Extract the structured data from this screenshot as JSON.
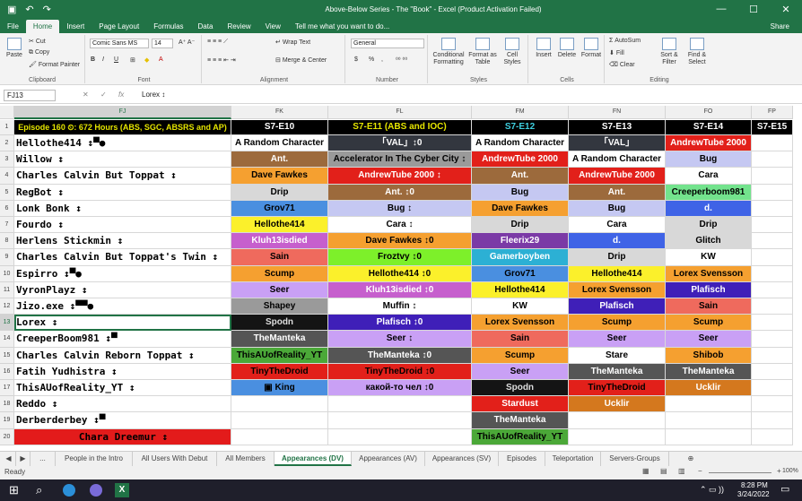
{
  "window": {
    "title": "Above-Below Series - The \"Book\" - Excel (Product Activation Failed)"
  },
  "quick_access": {
    "save": "▣",
    "undo": "↶",
    "redo": "↷"
  },
  "window_controls": {
    "min": "—",
    "max": "☐",
    "close": "✕"
  },
  "ribbon_tabs": [
    "File",
    "Home",
    "Insert",
    "Page Layout",
    "Formulas",
    "Data",
    "Review",
    "View"
  ],
  "tell_me": "Tell me what you want to do...",
  "share": "Share",
  "clipboard": {
    "paste": "Paste",
    "cut": "Cut",
    "copy": "Copy",
    "format_painter": "Format Painter",
    "label": "Clipboard"
  },
  "font": {
    "name": "Comic Sans MS",
    "size": "14",
    "bold": "B",
    "italic": "I",
    "underline": "U",
    "label": "Font"
  },
  "alignment": {
    "wrap": "Wrap Text",
    "merge": "Merge & Center",
    "label": "Alignment"
  },
  "number": {
    "format": "General",
    "currency": "$",
    "percent": "%",
    "comma": ",",
    "label": "Number"
  },
  "styles": {
    "conditional": "Conditional Formatting",
    "format_table": "Format as Table",
    "cell_styles": "Cell Styles",
    "label": "Styles"
  },
  "cells": {
    "insert": "Insert",
    "delete": "Delete",
    "format": "Format",
    "label": "Cells"
  },
  "editing": {
    "autosum": "AutoSum",
    "fill": "Fill",
    "clear": "Clear",
    "sort": "Sort & Filter",
    "find": "Find & Select",
    "label": "Editing"
  },
  "formula_bar": {
    "name_box": "FJ13",
    "fx": "fx",
    "value": "Lorex ↕"
  },
  "columns": {
    "fj": "FJ",
    "fk": "FK",
    "fl": "FL",
    "fm": "FM",
    "fn": "FN",
    "fo": "FO",
    "fp": "FP"
  },
  "row1": {
    "fj": "Episode 160 ⏲: 672 Hours (ABS, SGC, ABSRS and AP)",
    "fk": "S7-E10",
    "fl": "S7-E11 (ABS and IOC)",
    "fm": "S7-E12",
    "fn": "S7-E13",
    "fo": "S7-E14",
    "fp": "S7-E15"
  },
  "rows": [
    {
      "num": "2",
      "name": "Hellothe414 ↕▀●",
      "fk": "A Random Character",
      "fl": "「VAL」↕0",
      "fm": "A Random Character",
      "fn": "「VAL」",
      "fo": "AndrewTube 2000"
    },
    {
      "num": "3",
      "name": "Willow ↕",
      "fk": "Ant.",
      "fl": "Accelerator In The Cyber City ↕",
      "fm": "AndrewTube 2000",
      "fn": "A Random Character",
      "fo": "Bug"
    },
    {
      "num": "4",
      "name": "Charles Calvin But Toppat ↕",
      "fk": "Dave Fawkes",
      "fl": "AndrewTube 2000 ↕",
      "fm": "Ant.",
      "fn": "AndrewTube 2000",
      "fo": "Cara"
    },
    {
      "num": "5",
      "name": "RegBot ↕",
      "fk": "Drip",
      "fl": "Ant. ↕0",
      "fm": "Bug",
      "fn": "Ant.",
      "fo": "Creeperboom981"
    },
    {
      "num": "6",
      "name": "Lonk Bonk ↕",
      "fk": "Grov71",
      "fl": "Bug ↕",
      "fm": "Dave Fawkes",
      "fn": "Bug",
      "fo": "d."
    },
    {
      "num": "7",
      "name": "Fourdo ↕",
      "fk": "Hellothe414",
      "fl": "Cara ↕",
      "fm": "Drip",
      "fn": "Cara",
      "fo": "Drip"
    },
    {
      "num": "8",
      "name": "Herlens Stickmin ↕",
      "fk": "Kluh13isdied",
      "fl": "Dave Fawkes ↕0",
      "fm": "Fleerix29",
      "fn": "d.",
      "fo": "Glitch"
    },
    {
      "num": "9",
      "name": "Charles Calvin But Toppat's Twin ↕",
      "fk": "Sain",
      "fl": "Froztvy ↕0",
      "fm": "Gamerboyben",
      "fn": "Drip",
      "fo": "KW"
    },
    {
      "num": "10",
      "name": "Espirro ↕▀●",
      "fk": "Scump",
      "fl": "Hellothe414 ↕0",
      "fm": "Grov71",
      "fn": "Hellothe414",
      "fo": "Lorex Svensson"
    },
    {
      "num": "11",
      "name": "VyronPlayz ↕",
      "fk": "Seer",
      "fl": "Kluh13isdied ↕0",
      "fm": "Hellothe414",
      "fn": "Lorex Svensson",
      "fo": "Plafisch"
    },
    {
      "num": "12",
      "name": "Jizo.exe ↕▀▀●",
      "fk": "Shapey",
      "fl": "Muffin ↕",
      "fm": "KW",
      "fn": "Plafisch",
      "fo": "Sain"
    },
    {
      "num": "13",
      "name": "Lorex ↕",
      "fk": "Spodn",
      "fl": "Plafisch ↕0",
      "fm": "Lorex Svensson",
      "fn": "Scump",
      "fo": "Scump"
    },
    {
      "num": "14",
      "name": "CreeperBoom981 ↕▀",
      "fk": "TheManteka",
      "fl": "Seer ↕",
      "fm": "Sain",
      "fn": "Seer",
      "fo": "Seer"
    },
    {
      "num": "15",
      "name": "Charles Calvin Reborn Toppat ↕",
      "fk": "ThisAUofReality_YT",
      "fl": "TheManteka ↕0",
      "fm": "Scump",
      "fn": "Stare",
      "fo": "Shibob"
    },
    {
      "num": "16",
      "name": "Fatih Yudhistra ↕",
      "fk": "TinyTheDroid",
      "fl": "TinyTheDroid ↕0",
      "fm": "Seer",
      "fn": "TheManteka",
      "fo": "TheManteka"
    },
    {
      "num": "17",
      "name": "ThisAUofReality_YT ↕",
      "fk": "▣ King",
      "fl": "какой-то чел ↕0",
      "fm": "Spodn",
      "fn": "TinyTheDroid",
      "fo": "Ucklir"
    },
    {
      "num": "18",
      "name": "Reddo ↕",
      "fk": "",
      "fl": "",
      "fm": "Stardust",
      "fn": "Ucklir",
      "fo": ""
    },
    {
      "num": "19",
      "name": "Derberderbey ↕▀",
      "fk": "",
      "fl": "",
      "fm": "TheManteka",
      "fn": "",
      "fo": ""
    },
    {
      "num": "20",
      "name": "Chara Dreemur ↕",
      "fk": "",
      "fl": "",
      "fm": "ThisAUofReality_YT",
      "fn": "",
      "fo": ""
    }
  ],
  "sheet_tabs": [
    "...",
    "People in the Intro",
    "All Users With Debut",
    "All Members",
    "Appearances (DV)",
    "Appearances (AV)",
    "Appearances (SV)",
    "Episodes",
    "Teleportation",
    "Servers-Groups"
  ],
  "status": {
    "ready": "Ready",
    "zoom": "100%"
  },
  "taskbar": {
    "search": "⌕",
    "time": "8:28 PM",
    "date": "3/24/2022"
  },
  "colors": {
    "excel_green": "#217346"
  }
}
